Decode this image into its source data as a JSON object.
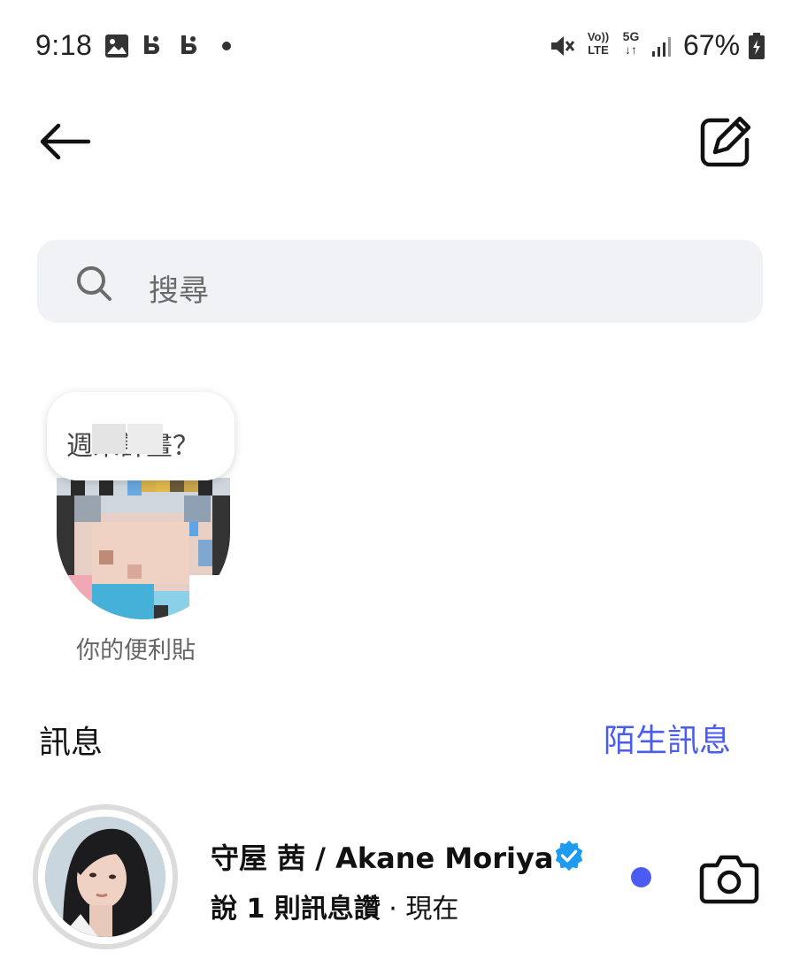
{
  "status_bar": {
    "time": "9:18",
    "battery": "67%",
    "network_volte": "Vo))",
    "network_lte": "LTE",
    "network_5g": "5G"
  },
  "header": {
    "username": ""
  },
  "search": {
    "placeholder": "搜尋"
  },
  "note": {
    "text": "週末計畫？",
    "label": "你的便利貼"
  },
  "messages": {
    "title": "訊息",
    "requests_label": "陌生訊息"
  },
  "conversations": [
    {
      "name": "守屋 茜 / Akane Moriya",
      "preview_bold": "說 1 則訊息讚",
      "preview_separator": " · ",
      "time": "現在",
      "verified": true,
      "unread": true
    }
  ],
  "colors": {
    "accent": "#4a5df0",
    "verified": "#1d9bf0",
    "search_bg": "#f1f2f5"
  },
  "icons": [
    "back-arrow-icon",
    "compose-icon",
    "search-icon",
    "verified-icon",
    "camera-icon",
    "image-icon",
    "mute-icon",
    "signal-icon",
    "battery-icon"
  ]
}
